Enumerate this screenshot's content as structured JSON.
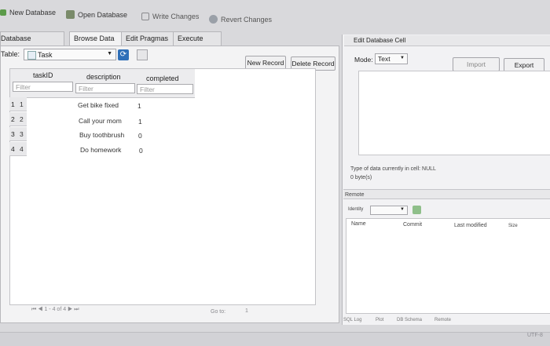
{
  "toolbar": {
    "new_database": "New Database",
    "open_database": "Open Database",
    "write_changes": "Write Changes",
    "revert_changes": "Revert Changes"
  },
  "tabs": [
    "Database Structure",
    "Browse Data",
    "Edit Pragmas",
    "Execute SQL"
  ],
  "browse": {
    "table_label": "Table:",
    "table_value": "Task",
    "new_record": "New Record",
    "delete_record": "Delete Record",
    "columns": [
      "taskID",
      "description",
      "completed"
    ],
    "filter_placeholder": "Filter",
    "rows": [
      {
        "num": "1",
        "taskID": "1",
        "description": "Get bike fixed",
        "completed": "1"
      },
      {
        "num": "2",
        "taskID": "2",
        "description": "Call your mom",
        "completed": "1"
      },
      {
        "num": "3",
        "taskID": "3",
        "description": "Buy toothbrush",
        "completed": "0"
      },
      {
        "num": "4",
        "taskID": "4",
        "description": "Do homework",
        "completed": "0"
      }
    ],
    "pager_text": "1 - 4 of 4",
    "goto_label": "Go to:",
    "goto_value": "1"
  },
  "edit_cell": {
    "title": "Edit Database Cell",
    "mode_label": "Mode:",
    "mode_value": "Text",
    "import": "Import",
    "export": "Export",
    "type_info": "Type of data currently in cell: NULL",
    "size_info": "0 byte(s)"
  },
  "remote": {
    "title": "Remote",
    "identity_label": "Identity",
    "columns": [
      "Name",
      "Commit",
      "Last modified",
      "Size"
    ]
  },
  "bottom_tabs": [
    "SQL Log",
    "Plot",
    "DB Schema",
    "Remote"
  ],
  "status": "UTF-8",
  "colors": {
    "accent": "#3a78c9",
    "panel": "#f3f3f4",
    "grid": "#ffffff"
  }
}
